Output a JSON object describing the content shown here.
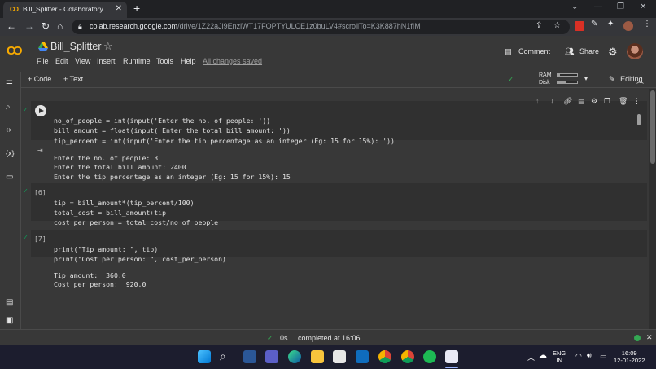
{
  "browser": {
    "tab_title": "Bill_Splitter - Colaboratory",
    "tab_favicon": "CO",
    "url_host": "colab.research.google.com",
    "url_path": "/drive/1Z22aJi9EnzlWT17FOPTYULCE1z0buLV4#scrollTo=K3K887hN1fIM"
  },
  "colab": {
    "logo": "CO",
    "notebook_title": "Bill_Splitter",
    "menu": [
      "File",
      "Edit",
      "View",
      "Insert",
      "Runtime",
      "Tools",
      "Help"
    ],
    "save_status": "All changes saved",
    "comment_label": "Comment",
    "share_label": "Share",
    "toolbar": {
      "add_code": "+ Code",
      "add_text": "+ Text",
      "ram_label": "RAM",
      "disk_label": "Disk",
      "editing_label": "Editing"
    }
  },
  "cells": [
    {
      "exec_count": "",
      "code": [
        "no_of_people = int(input('Enter the no. of people: '))",
        "bill_amount = float(input('Enter the total bill amount: '))",
        "tip_percent = int(input('Enter the tip percentage as an integer (Eg: 15 for 15%): '))"
      ],
      "output": [
        "Enter the no. of people: 3",
        "Enter the total bill amount: 2400",
        "Enter the tip percentage as an integer (Eg: 15 for 15%): 15"
      ]
    },
    {
      "exec_count": "[6]",
      "code": [
        "tip = bill_amount*(tip_percent/100)",
        "total_cost = bill_amount+tip",
        "cost_per_person = total_cost/no_of_people"
      ],
      "output": []
    },
    {
      "exec_count": "[7]",
      "code": [
        "print(\"Tip amount: \", tip)",
        "print(\"Cost per person: \", cost_per_person)"
      ],
      "output": [
        "Tip amount:  360.0",
        "Cost per person:  920.0"
      ]
    }
  ],
  "status": {
    "elapsed": "0s",
    "message": "completed at 16:06"
  },
  "taskbar": {
    "lang_top": "ENG",
    "lang_bottom": "IN",
    "time": "16:09",
    "date": "12-01-2022"
  },
  "colors": {
    "accent_orange": "#f9ab00",
    "ok_green": "#34a853"
  }
}
